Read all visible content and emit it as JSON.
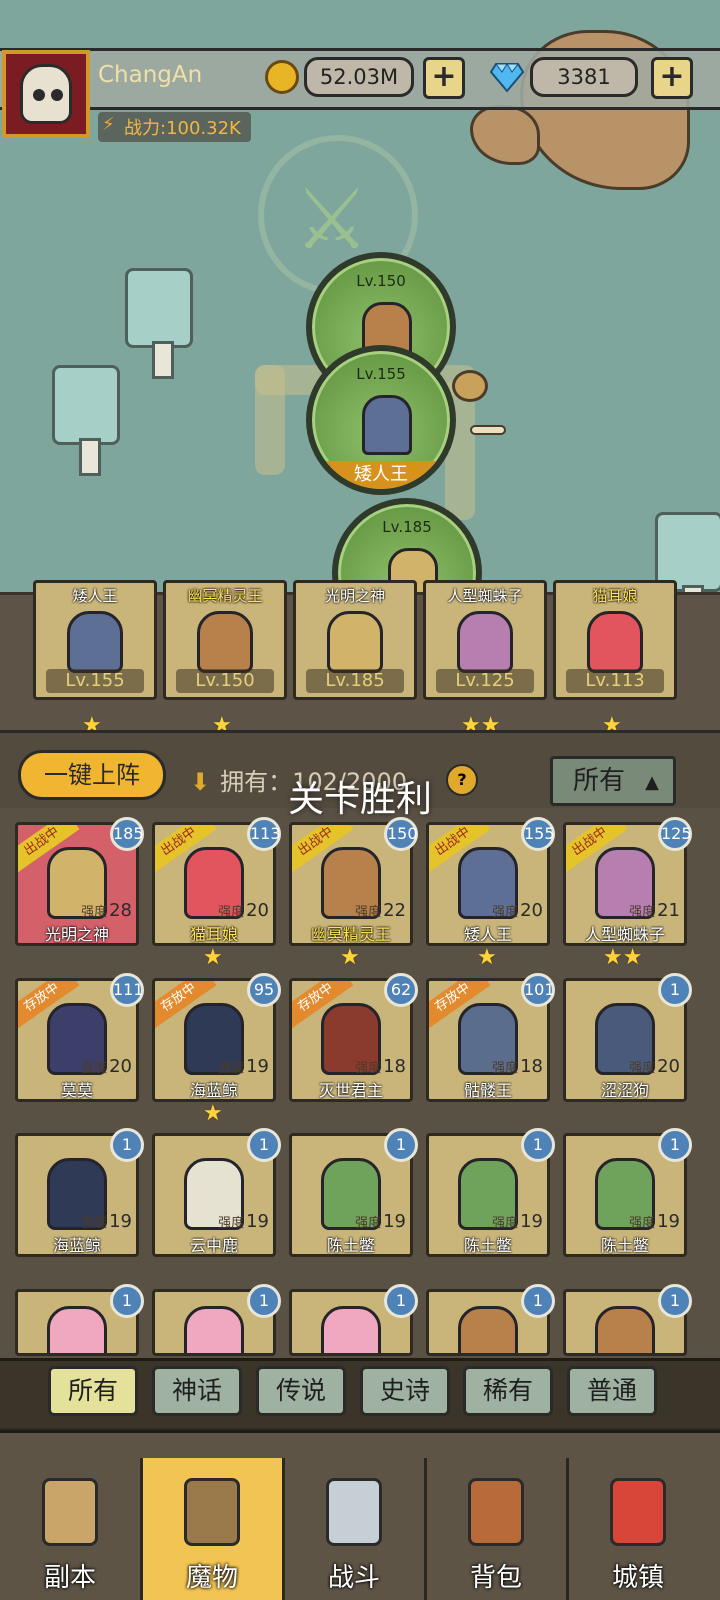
{
  "player": {
    "name": "ChangAn",
    "power_label": "战力:100.32K"
  },
  "resources": {
    "gold": "52.03M",
    "gems": "3381",
    "plus": "+"
  },
  "map": {
    "stages": [
      {
        "level": "Lv.150",
        "name": ""
      },
      {
        "level": "Lv.155",
        "name": "矮人王"
      },
      {
        "level": "Lv.185",
        "name": ""
      }
    ]
  },
  "team": [
    {
      "name": "矮人王",
      "level": "Lv.155",
      "stars": "★",
      "name_color": "white",
      "portrait_color": "#5d6f95"
    },
    {
      "name": "幽冥精灵王",
      "level": "Lv.150",
      "stars": "★",
      "name_color": "gold",
      "portrait_color": "#b8804a"
    },
    {
      "name": "光明之神",
      "level": "Lv.185",
      "stars": "",
      "name_color": "white",
      "portrait_color": "#d2b36a"
    },
    {
      "name": "人型蜘蛛子",
      "level": "Lv.125",
      "stars": "★★",
      "name_color": "white",
      "portrait_color": "#b77fb0"
    },
    {
      "name": "猫耳娘",
      "level": "Lv.113",
      "stars": "★",
      "name_color": "gold",
      "portrait_color": "#e2545e"
    }
  ],
  "controls": {
    "deploy_label": "一键上阵",
    "owned_label": "拥有：102/2000",
    "help": "?",
    "filter_label": "所有",
    "filter_caret": "▲",
    "victory_toast": "关卡胜利"
  },
  "monsters": [
    {
      "name": "光明之神",
      "level": "185",
      "status": "出战中",
      "strength_label": "强度",
      "strength": "28",
      "stars": "",
      "name_color": "white",
      "bg": "#d4606a",
      "portrait_color": "#d2b36a"
    },
    {
      "name": "猫耳娘",
      "level": "113",
      "status": "出战中",
      "strength_label": "强度",
      "strength": "20",
      "stars": "★",
      "name_color": "gold",
      "bg": "#c9b57a",
      "portrait_color": "#e2545e"
    },
    {
      "name": "幽冥精灵王",
      "level": "150",
      "status": "出战中",
      "strength_label": "强度",
      "strength": "22",
      "stars": "★",
      "name_color": "gold",
      "bg": "#c9b57a",
      "portrait_color": "#b8804a"
    },
    {
      "name": "矮人王",
      "level": "155",
      "status": "出战中",
      "strength_label": "强度",
      "strength": "20",
      "stars": "★",
      "name_color": "white",
      "bg": "#c9b57a",
      "portrait_color": "#5d6f95"
    },
    {
      "name": "人型蜘蛛子",
      "level": "125",
      "status": "出战中",
      "strength_label": "强度",
      "strength": "21",
      "stars": "★★",
      "name_color": "white",
      "bg": "#c9b57a",
      "portrait_color": "#b77fb0"
    },
    {
      "name": "莫莫",
      "level": "111",
      "status": "存放中",
      "strength_label": "强度",
      "strength": "20",
      "stars": "",
      "name_color": "white",
      "bg": "#c9b57a",
      "portrait_color": "#3c3f6a"
    },
    {
      "name": "海蓝鲸",
      "level": "95",
      "status": "存放中",
      "strength_label": "强度",
      "strength": "19",
      "stars": "★",
      "name_color": "white",
      "bg": "#c9b57a",
      "portrait_color": "#2f3a56"
    },
    {
      "name": "灭世君主",
      "level": "62",
      "status": "存放中",
      "strength_label": "强度",
      "strength": "18",
      "stars": "",
      "name_color": "white",
      "bg": "#c9b57a",
      "portrait_color": "#8a3b2e"
    },
    {
      "name": "骷髅王",
      "level": "101",
      "status": "存放中",
      "strength_label": "强度",
      "strength": "18",
      "stars": "",
      "name_color": "white",
      "bg": "#c9b57a",
      "portrait_color": "#5b6d8c"
    },
    {
      "name": "涩涩狗",
      "level": "1",
      "status": "",
      "strength_label": "强度",
      "strength": "20",
      "stars": "",
      "name_color": "white",
      "bg": "#c9b57a",
      "portrait_color": "#4a5a7a"
    },
    {
      "name": "海蓝鲸",
      "level": "1",
      "status": "",
      "strength_label": "强度",
      "strength": "19",
      "stars": "",
      "name_color": "white",
      "bg": "#c9b57a",
      "portrait_color": "#2f3a56"
    },
    {
      "name": "云中鹿",
      "level": "1",
      "status": "",
      "strength_label": "强度",
      "strength": "19",
      "stars": "",
      "name_color": "white",
      "bg": "#c9b57a",
      "portrait_color": "#e6e2d2"
    },
    {
      "name": "陈土鳖",
      "level": "1",
      "status": "",
      "strength_label": "强度",
      "strength": "19",
      "stars": "",
      "name_color": "white",
      "bg": "#c9b57a",
      "portrait_color": "#6fa25a"
    },
    {
      "name": "陈土鳖",
      "level": "1",
      "status": "",
      "strength_label": "强度",
      "strength": "19",
      "stars": "",
      "name_color": "white",
      "bg": "#c9b57a",
      "portrait_color": "#6fa25a"
    },
    {
      "name": "陈土鳖",
      "level": "1",
      "status": "",
      "strength_label": "强度",
      "strength": "19",
      "stars": "",
      "name_color": "white",
      "bg": "#c9b57a",
      "portrait_color": "#6fa25a"
    },
    {
      "name": "",
      "level": "1",
      "status": "",
      "strength_label": "",
      "strength": "",
      "stars": "",
      "name_color": "white",
      "bg": "#c9b57a",
      "portrait_color": "#f0a8c0"
    },
    {
      "name": "",
      "level": "1",
      "status": "",
      "strength_label": "",
      "strength": "",
      "stars": "",
      "name_color": "white",
      "bg": "#c9b57a",
      "portrait_color": "#f0a8c0"
    },
    {
      "name": "",
      "level": "1",
      "status": "",
      "strength_label": "",
      "strength": "",
      "stars": "",
      "name_color": "white",
      "bg": "#c9b57a",
      "portrait_color": "#f0a8c0"
    },
    {
      "name": "",
      "level": "1",
      "status": "",
      "strength_label": "",
      "strength": "",
      "stars": "",
      "name_color": "white",
      "bg": "#c9b57a",
      "portrait_color": "#b8804a"
    },
    {
      "name": "",
      "level": "1",
      "status": "",
      "strength_label": "",
      "strength": "",
      "stars": "",
      "name_color": "white",
      "bg": "#c9b57a",
      "portrait_color": "#b8804a"
    }
  ],
  "rarity_tabs": [
    {
      "label": "所有",
      "active": true
    },
    {
      "label": "神话",
      "active": false
    },
    {
      "label": "传说",
      "active": false
    },
    {
      "label": "史诗",
      "active": false
    },
    {
      "label": "稀有",
      "active": false
    },
    {
      "label": "普通",
      "active": false
    }
  ],
  "nav": [
    {
      "label": "副本",
      "icon": "map-scroll-icon",
      "active": false,
      "icon_color": "#c9a56a"
    },
    {
      "label": "魔物",
      "icon": "helmet-icon",
      "active": true,
      "icon_color": "#9a7a4a"
    },
    {
      "label": "战斗",
      "icon": "crossed-swords-icon",
      "active": false,
      "icon_color": "#c7cfd6"
    },
    {
      "label": "背包",
      "icon": "backpack-icon",
      "active": false,
      "icon_color": "#b86a3a"
    },
    {
      "label": "城镇",
      "icon": "shop-icon",
      "active": false,
      "icon_color": "#d8463a"
    }
  ]
}
